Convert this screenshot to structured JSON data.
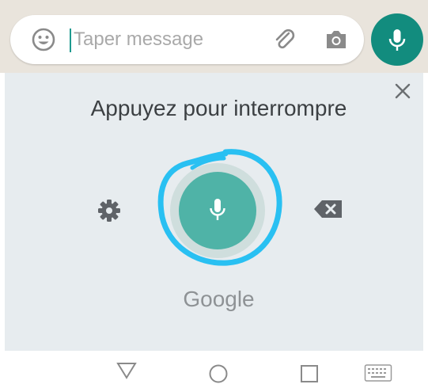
{
  "chat_input": {
    "placeholder": "Taper message",
    "emoji_icon": "emoji-icon",
    "attach_icon": "paperclip-icon",
    "camera_icon": "camera-icon",
    "mic_icon": "microphone-icon"
  },
  "voice_input": {
    "prompt": "Appuyez pour interrompre",
    "brand": "Google",
    "accent_color": "#4fb3a7",
    "highlight_color": "#29c0f2",
    "close_icon": "close-icon",
    "settings_icon": "gear-icon",
    "backspace_icon": "backspace-icon"
  },
  "nav": {
    "back_icon": "triangle-back-icon",
    "home_icon": "circle-home-icon",
    "recent_icon": "square-recent-icon",
    "keyboard_icon": "keyboard-icon"
  }
}
